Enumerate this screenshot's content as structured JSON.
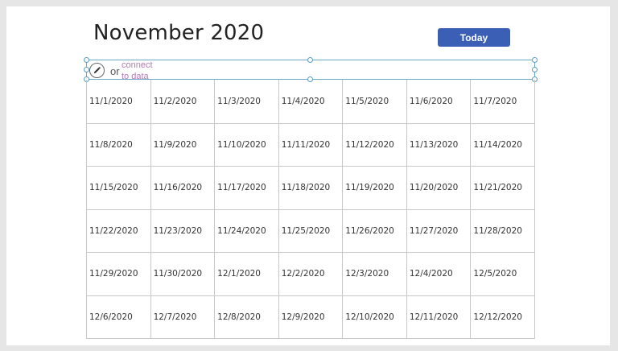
{
  "calendar": {
    "month_title": "November 2020",
    "today_label": "Today",
    "placeholder_or": "or",
    "placeholder_link": "connect to data",
    "accent_color": "#3a5fb4",
    "weeks": [
      [
        "11/1/2020",
        "11/2/2020",
        "11/3/2020",
        "11/4/2020",
        "11/5/2020",
        "11/6/2020",
        "11/7/2020"
      ],
      [
        "11/8/2020",
        "11/9/2020",
        "11/10/2020",
        "11/11/2020",
        "11/12/2020",
        "11/13/2020",
        "11/14/2020"
      ],
      [
        "11/15/2020",
        "11/16/2020",
        "11/17/2020",
        "11/18/2020",
        "11/19/2020",
        "11/20/2020",
        "11/21/2020"
      ],
      [
        "11/22/2020",
        "11/23/2020",
        "11/24/2020",
        "11/25/2020",
        "11/26/2020",
        "11/27/2020",
        "11/28/2020"
      ],
      [
        "11/29/2020",
        "11/30/2020",
        "12/1/2020",
        "12/2/2020",
        "12/3/2020",
        "12/4/2020",
        "12/5/2020"
      ],
      [
        "12/6/2020",
        "12/7/2020",
        "12/8/2020",
        "12/9/2020",
        "12/10/2020",
        "12/11/2020",
        "12/12/2020"
      ]
    ]
  },
  "icons": {
    "edit": "pencil-icon"
  }
}
